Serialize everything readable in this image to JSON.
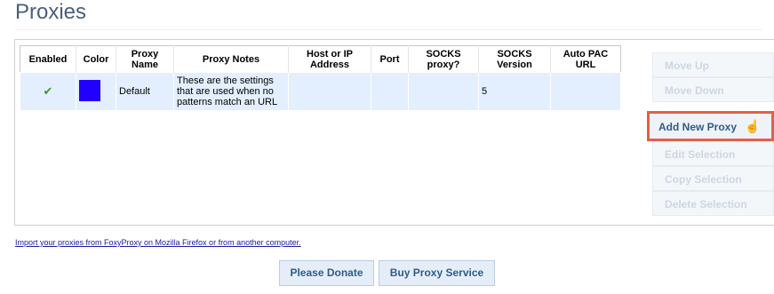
{
  "page": {
    "title": "Proxies"
  },
  "table": {
    "headers": [
      "Enabled",
      "Color",
      "Proxy Name",
      "Proxy Notes",
      "Host or IP Address",
      "Port",
      "SOCKS proxy?",
      "SOCKS Version",
      "Auto PAC URL"
    ],
    "rows": [
      {
        "enabled": "✔",
        "color": "#2200ff",
        "name": "Default",
        "notes": "These are the settings that are used when no patterns match an URL",
        "host": "",
        "port": "",
        "socks": "",
        "socks_version": "5",
        "pac_url": ""
      }
    ]
  },
  "side_buttons": {
    "move_up": "Move Up",
    "move_down": "Move Down",
    "add_new": "Add New Proxy",
    "edit": "Edit Selection",
    "copy": "Copy Selection",
    "delete": "Delete Selection"
  },
  "import_link": "Import your proxies from FoxyProxy on Mozilla Firefox or from another computer.",
  "bottom_buttons": {
    "donate": "Please Donate",
    "buy": "Buy Proxy Service"
  },
  "colors": {
    "accent": "#2f5b88",
    "highlight_border": "#e0604a",
    "row_selected": "#e3efff"
  }
}
